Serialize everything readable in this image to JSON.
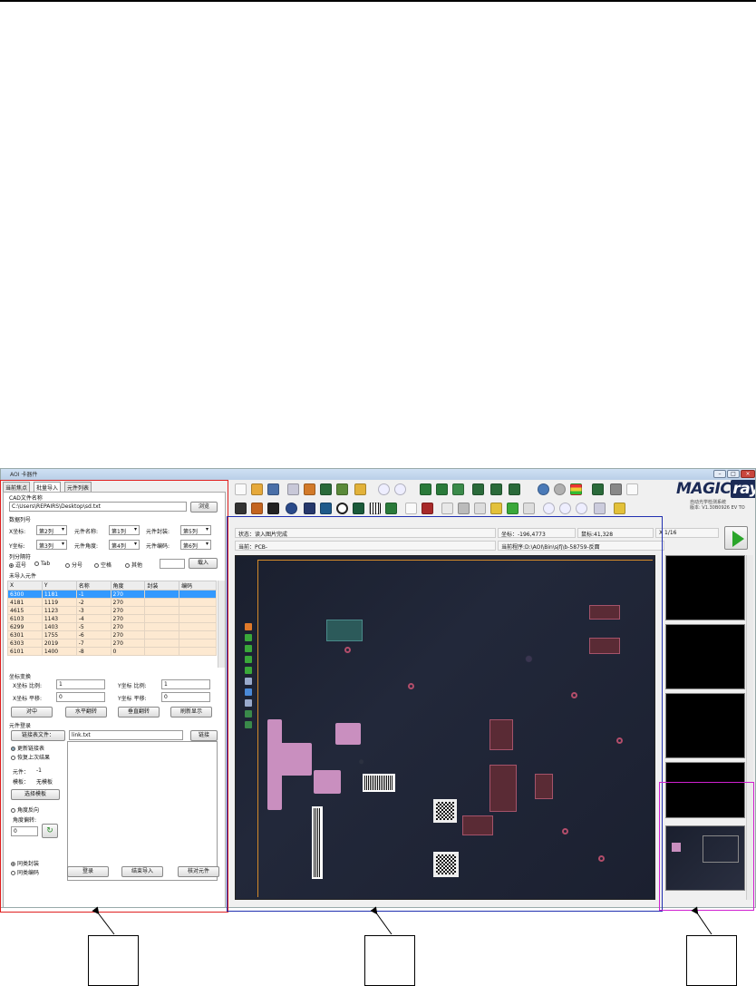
{
  "window": {
    "title": "AOI 卡器件"
  },
  "left_panel": {
    "tabs": [
      "当前焦点",
      "批量导入",
      "元件列表"
    ],
    "cad_label": "CAD文件名称",
    "cad_path": "C:\\Users\\REPAIRS\\Desktop\\sd.txt",
    "browse_button": "浏览",
    "data_columns_label": "数据列号",
    "x_label": "X坐标:",
    "x_col": "第2列",
    "part_name_label": "元件名称:",
    "part_name_col": "第1列",
    "package_label": "元件封装:",
    "package_col": "第5列",
    "y_label": "Y坐标:",
    "y_col": "第3列",
    "angle_label": "元件角度:",
    "angle_col": "第4列",
    "code_label": "元件编码:",
    "code_col": "第6列",
    "separator_label": "列分隔符",
    "sep_options": [
      "逗号",
      "Tab",
      "分号",
      "空格",
      "其他"
    ],
    "load_button": "载入",
    "unimported_label": "未导入元件",
    "columns": [
      "X",
      "Y",
      "名称",
      "角度",
      "封装",
      "编码"
    ],
    "rows": [
      [
        "6300",
        "1181",
        "-1",
        "270",
        "",
        ""
      ],
      [
        "4181",
        "1119",
        "-2",
        "270",
        "",
        ""
      ],
      [
        "4615",
        "1123",
        "-3",
        "270",
        "",
        ""
      ],
      [
        "6103",
        "1143",
        "-4",
        "270",
        "",
        ""
      ],
      [
        "6299",
        "1403",
        "-5",
        "270",
        "",
        ""
      ],
      [
        "6301",
        "1755",
        "-6",
        "270",
        "",
        ""
      ],
      [
        "6303",
        "2019",
        "-7",
        "270",
        "",
        ""
      ],
      [
        "6101",
        "1400",
        "-8",
        "0",
        "",
        ""
      ]
    ],
    "transform_label": "坐标变换",
    "x_scale_label": "X坐标 比例:",
    "x_scale": "1",
    "y_scale_label": "Y坐标 比例:",
    "y_scale": "1",
    "x_shift_label": "X坐标 平移:",
    "x_shift": "0",
    "y_shift_label": "Y坐标 平移:",
    "y_shift": "0",
    "align_button": "对中",
    "hflip_button": "水平翻转",
    "vflip_button": "垂直翻转",
    "refresh_button": "刷新显示",
    "register_label": "元件登录",
    "link_button": "链接表文件：",
    "link_file": "link.txt",
    "link_action_button": "链接",
    "update_chk": "更新链接表",
    "restore_chk": "恢复上次结果",
    "part_label": "元件：",
    "part_value": "-1",
    "template_label": "模板：",
    "template_value": "无模板",
    "select_template_button": "选择模板",
    "reverse_chk": "角度反向",
    "angle_offset_label": "角度偏转:",
    "angle_offset": "0",
    "same_pkg_radio": "同类封装",
    "same_code_radio": "同类编码",
    "login_button": "登录",
    "finish_button": "结束导入",
    "check_button": "核对元件"
  },
  "status": {
    "state": "状态：读入图片完成",
    "coord": "坐标：-196,4773",
    "mouse": "鼠标:41,328",
    "page": "X 1/16",
    "current": "当前：PCB-",
    "program": "当前程序:D:\\AOI\\Bin\\sjfj\\b-58759-反面"
  },
  "logo": {
    "main": "MAGIC",
    "accent": "ray",
    "sub1": "自动光学检测系统",
    "sub2": "版本: V1.30B0926 EV TO"
  },
  "icons": [
    "new-icon",
    "open-icon",
    "save-icon",
    "zoom-in-icon",
    "zoom-out-icon",
    "settings-icon",
    "traffic-light-icon",
    "tools-icon",
    "play-icon"
  ]
}
